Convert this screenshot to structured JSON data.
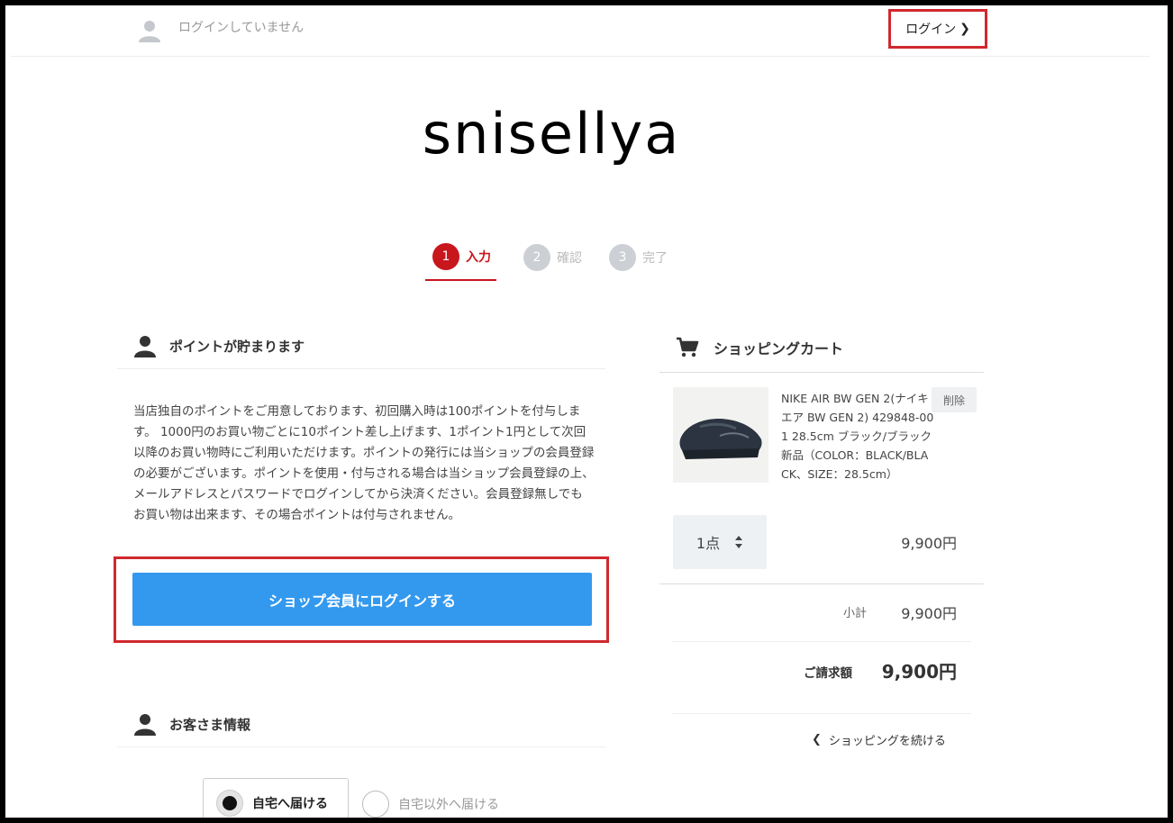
{
  "header": {
    "login_status": "ログインしていません",
    "login_link": "ログイン",
    "login_chevron": "❯"
  },
  "shop": {
    "logo_text": "snisellya"
  },
  "steps": [
    {
      "num": "1",
      "label": "入力",
      "state": "active"
    },
    {
      "num": "2",
      "label": "確認",
      "state": "inactive"
    },
    {
      "num": "3",
      "label": "完了",
      "state": "inactive"
    }
  ],
  "points": {
    "title": "ポイントが貯まります",
    "description": "当店独自のポイントをご用意しております、初回購入時は100ポイントを付与します。 1000円のお買い物ごとに10ポイント差し上げます、1ポイント1円として次回以降のお買い物時にご利用いただけます。ポイントの発行には当ショップの会員登録の必要がございます。ポイントを使用・付与される場合は当ショップ会員登録の上、メールアドレスとパスワードでログインしてから決済ください。会員登録無しでもお買い物は出来ます、その場合ポイントは付与されません。",
    "login_button": "ショップ会員にログインする"
  },
  "customer": {
    "title": "お客さま情報",
    "delivery_options": [
      {
        "label": "自宅へ届ける",
        "selected": true
      },
      {
        "label": "自宅以外へ届ける",
        "selected": false
      }
    ]
  },
  "cart": {
    "title": "ショッピングカート",
    "item": {
      "name": "NIKE AIR BW GEN 2(ナイキ エア BW GEN 2) 429848-001 28.5cm ブラック/ブラック 新品（COLOR：BLACK/BLACK、SIZE：28.5cm）",
      "delete_label": "削除",
      "quantity": "1点",
      "price": "9,900円"
    },
    "subtotal_label": "小計",
    "subtotal_value": "9,900円",
    "total_label": "ご請求額",
    "total_value": "9,900円",
    "continue_label": "ショッピングを続ける",
    "continue_chevron": "❮"
  },
  "colors": {
    "accent_red": "#c8161d",
    "button_blue": "#3399ee",
    "highlight_frame": "#d0282e"
  }
}
